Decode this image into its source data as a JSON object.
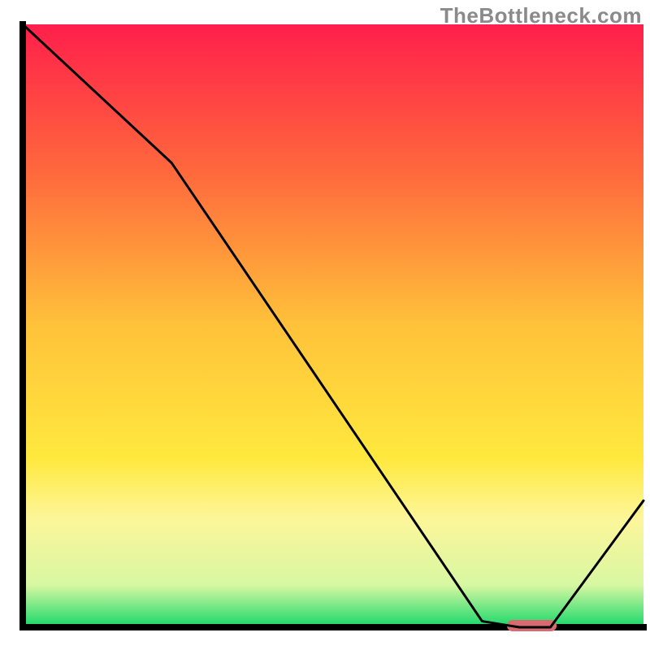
{
  "watermark": "TheBottleneck.com",
  "chart_data": {
    "type": "line",
    "title": "",
    "xlabel": "",
    "ylabel": "",
    "xlim": [
      0,
      100
    ],
    "ylim": [
      0,
      100
    ],
    "series": [
      {
        "name": "curve",
        "x": [
          0,
          24,
          74,
          80,
          85,
          100
        ],
        "values": [
          100,
          77,
          1,
          0,
          0,
          21
        ]
      }
    ],
    "marker": {
      "name": "optimal-range",
      "x_start": 78,
      "x_end": 86,
      "y": 0,
      "color": "#d96a6f"
    },
    "gradient_stops": [
      {
        "offset": 0.0,
        "color": "#ff1f4b"
      },
      {
        "offset": 0.25,
        "color": "#ff6a3c"
      },
      {
        "offset": 0.5,
        "color": "#ffc23a"
      },
      {
        "offset": 0.72,
        "color": "#ffe93e"
      },
      {
        "offset": 0.82,
        "color": "#fdf69a"
      },
      {
        "offset": 0.93,
        "color": "#d8f7a2"
      },
      {
        "offset": 1.0,
        "color": "#17d86a"
      }
    ],
    "axis_color": "#000000",
    "axis_width": 4,
    "line_color": "#000000",
    "line_width": 3
  }
}
